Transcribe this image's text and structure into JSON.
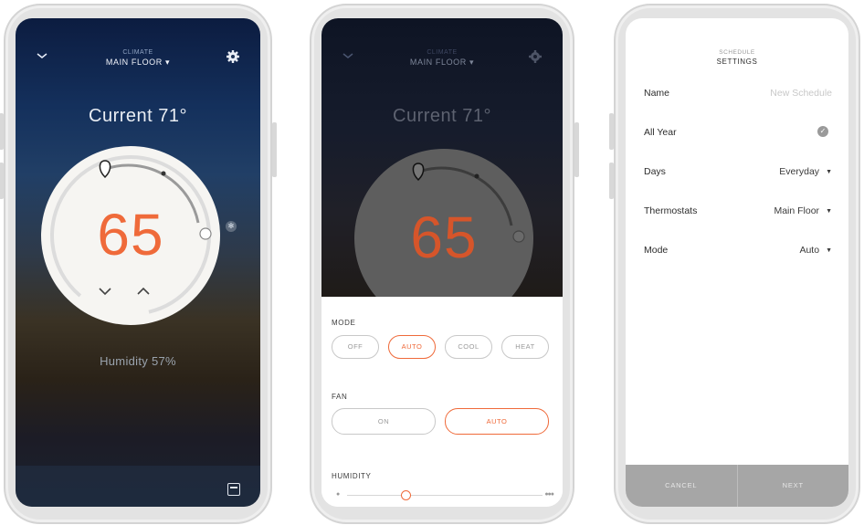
{
  "colors": {
    "accent": "#ef6a3a",
    "night_top": "#0c1c40",
    "footer_gray": "#a6a6a6"
  },
  "screen1": {
    "header_small": "CLIMATE",
    "header_big": "MAIN FLOOR ▾",
    "current": "Current 71°",
    "setpoint": "65",
    "humidity": "Humidity 57%",
    "icons": [
      "chevron-down-icon",
      "gear-icon",
      "fan-icon",
      "chevron-up-icon",
      "calendar-icon"
    ]
  },
  "screen2": {
    "header_small": "CLIMATE",
    "header_big": "MAIN FLOOR ▾",
    "current": "Current 71°",
    "setpoint": "65",
    "mode_label": "MODE",
    "modes": [
      "OFF",
      "AUTO",
      "COOL",
      "HEAT"
    ],
    "mode_selected": "AUTO",
    "fan_label": "FAN",
    "fan_options": [
      "ON",
      "AUTO"
    ],
    "fan_selected": "AUTO",
    "humidity_label": "HUMIDITY",
    "humidity_level": 0.3
  },
  "screen3": {
    "title_small": "SCHEDULE",
    "title_big": "SETTINGS",
    "rows": [
      {
        "label": "Name",
        "value": "New Schedule"
      },
      {
        "label": "All Year",
        "value": "✓"
      },
      {
        "label": "Days",
        "value": "Everyday"
      },
      {
        "label": "Thermostats",
        "value": "Main Floor"
      },
      {
        "label": "Mode",
        "value": "Auto"
      }
    ],
    "cancel": "CANCEL",
    "next": "NEXT"
  }
}
